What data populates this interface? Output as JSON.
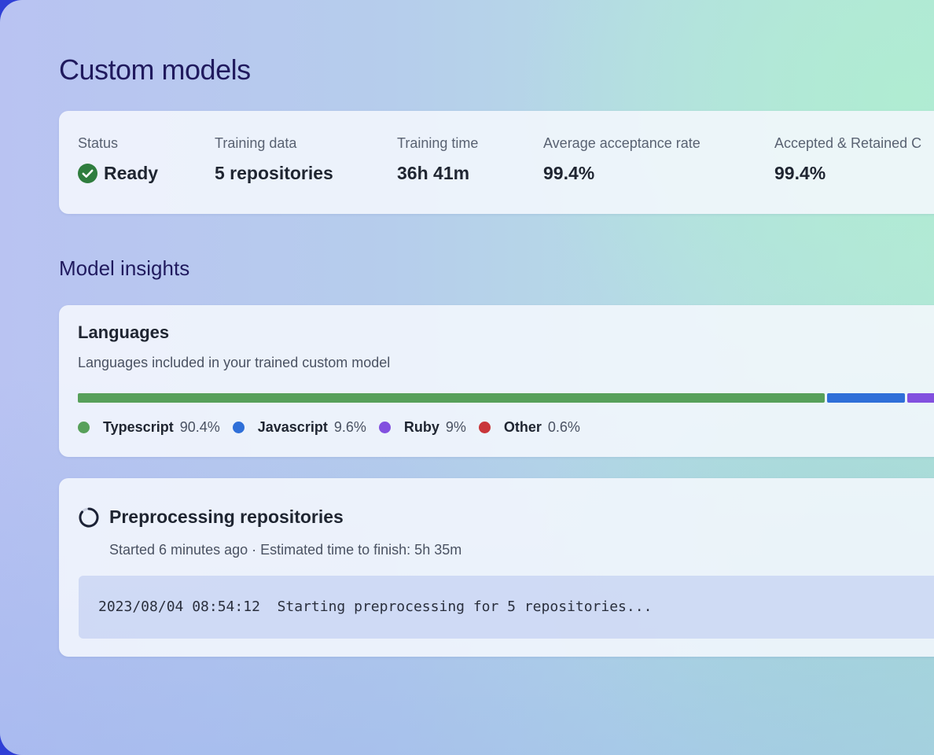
{
  "page": {
    "title": "Custom models"
  },
  "stats": [
    {
      "label": "Status",
      "value": "Ready",
      "icon": "check-circle-icon"
    },
    {
      "label": "Training data",
      "value": "5 repositories"
    },
    {
      "label": "Training time",
      "value": "36h 41m"
    },
    {
      "label": "Average acceptance rate",
      "value": "99.4%"
    },
    {
      "label": "Accepted & Retained C",
      "value": "99.4%"
    }
  ],
  "insights": {
    "title": "Model insights",
    "languages": {
      "title": "Languages",
      "description": "Languages included in your trained custom model",
      "items": [
        {
          "name": "Typescript",
          "percent": "90.4%",
          "share": 90.4,
          "color": "#57a05a"
        },
        {
          "name": "Javascript",
          "percent": "9.6%",
          "share": 9.6,
          "color": "#2f6fd8"
        },
        {
          "name": "Ruby",
          "percent": "9%",
          "share": 9,
          "color": "#8250df"
        },
        {
          "name": "Other",
          "percent": "0.6%",
          "share": 0.6,
          "color": "#c9363a"
        }
      ]
    }
  },
  "preprocessing": {
    "title": "Preprocessing repositories",
    "meta": "Started 6 minutes ago · Estimated time to finish: 5h 35m",
    "log": "2023/08/04 08:54:12  Starting preprocessing for 5 repositories...",
    "icon": "spinner-icon"
  },
  "colors": {
    "status_ready": "#2f7d3e",
    "title_text": "#201a5e"
  }
}
